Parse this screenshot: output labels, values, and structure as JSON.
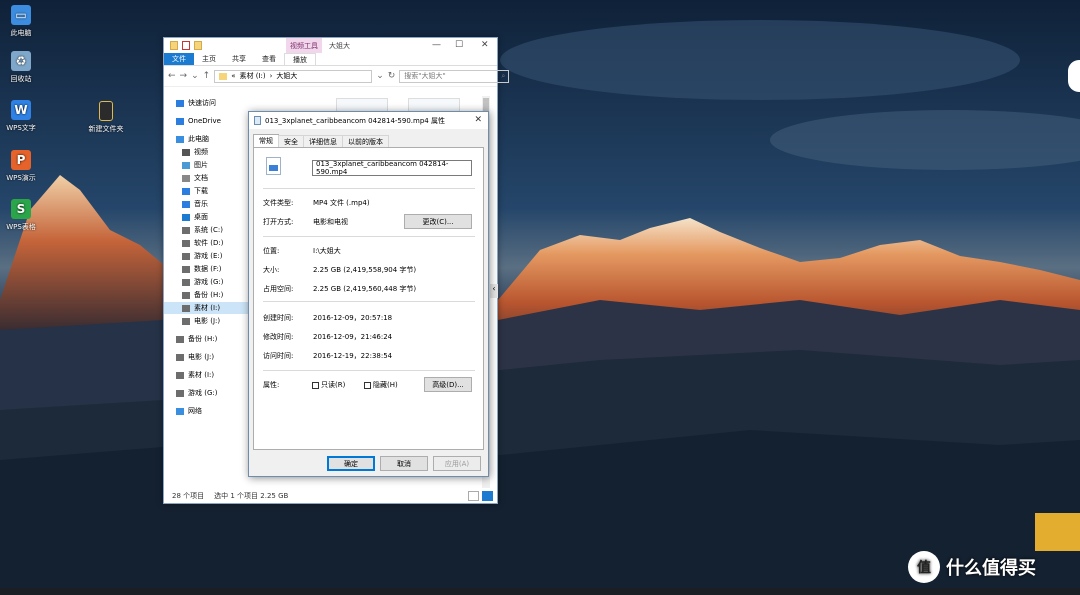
{
  "desktop": {
    "icons": [
      {
        "label": "此电脑",
        "icon": "computer-icon",
        "color": "#3c8de0"
      },
      {
        "label": "回收站",
        "icon": "recycle-bin-icon",
        "color": "#7fa7c9"
      },
      {
        "label": "WPS文字",
        "icon": "wps-writer-icon",
        "color": "#2f82e4",
        "glyph": "W"
      },
      {
        "label": "WPS演示",
        "icon": "wps-presentation-icon",
        "color": "#e5622b",
        "glyph": "P"
      },
      {
        "label": "WPS表格",
        "icon": "wps-spreadsheet-icon",
        "color": "#2aa54a",
        "glyph": "S"
      },
      {
        "label": "新建文件夹",
        "icon": "folder-icon",
        "color": "#2b2b2b"
      }
    ]
  },
  "explorer": {
    "context_tab": "视频工具",
    "window_title": "大姐大",
    "ribbon_tabs": [
      "文件",
      "主页",
      "共享",
      "查看",
      "播放"
    ],
    "address_parts": [
      "素材 (I:)",
      "大姐大"
    ],
    "search_placeholder": "搜索\"大姐大\"",
    "nav": [
      {
        "label": "快速访问",
        "icon": "star-icon",
        "indent": 0
      },
      {
        "label": "OneDrive",
        "icon": "cloud-icon",
        "indent": 0
      },
      {
        "label": "此电脑",
        "icon": "computer-icon",
        "indent": 0
      },
      {
        "label": "视频",
        "icon": "video-icon",
        "indent": 1
      },
      {
        "label": "图片",
        "icon": "picture-icon",
        "indent": 1
      },
      {
        "label": "文档",
        "icon": "document-icon",
        "indent": 1
      },
      {
        "label": "下载",
        "icon": "download-icon",
        "indent": 1
      },
      {
        "label": "音乐",
        "icon": "music-icon",
        "indent": 1
      },
      {
        "label": "桌面",
        "icon": "desktop-icon",
        "indent": 1
      },
      {
        "label": "系统 (C:)",
        "icon": "drive-icon",
        "indent": 1
      },
      {
        "label": "软件 (D:)",
        "icon": "drive-icon",
        "indent": 1
      },
      {
        "label": "游戏 (E:)",
        "icon": "drive-icon",
        "indent": 1
      },
      {
        "label": "数据 (F:)",
        "icon": "drive-icon",
        "indent": 1
      },
      {
        "label": "游戏 (G:)",
        "icon": "drive-icon",
        "indent": 1
      },
      {
        "label": "备份 (H:)",
        "icon": "drive-icon",
        "indent": 1
      },
      {
        "label": "素材 (I:)",
        "icon": "drive-icon",
        "indent": 1,
        "selected": true
      },
      {
        "label": "电影 (J:)",
        "icon": "drive-icon",
        "indent": 1
      },
      {
        "label": "备份 (H:)",
        "icon": "drive-icon",
        "indent": 0
      },
      {
        "label": "电影 (J:)",
        "icon": "drive-icon",
        "indent": 0
      },
      {
        "label": "素材 (I:)",
        "icon": "drive-icon",
        "indent": 0
      },
      {
        "label": "游戏 (G:)",
        "icon": "drive-icon",
        "indent": 0
      },
      {
        "label": "网络",
        "icon": "network-icon",
        "indent": 0
      }
    ],
    "status": {
      "count": "28 个项目",
      "selection": "选中 1 个项目  2.25 GB"
    }
  },
  "dialog": {
    "title": "013_3xplanet_caribbeancom 042814-590.mp4 属性",
    "tabs": [
      "常规",
      "安全",
      "详细信息",
      "以前的版本"
    ],
    "file_name": "013_3xplanet_caribbeancom 042814-590.mp4",
    "type_label": "文件类型:",
    "type_value": "MP4 文件 (.mp4)",
    "open_label": "打开方式:",
    "open_value": "电影和电视",
    "change_button": "更改(C)...",
    "location_label": "位置:",
    "location_value": "I:\\大姐大",
    "size_label": "大小:",
    "size_value": "2.25 GB (2,419,558,904 字节)",
    "disk_label": "占用空间:",
    "disk_value": "2.25 GB (2,419,560,448 字节)",
    "created_label": "创建时间:",
    "created_value": "2016-12-09，20:57:18",
    "modified_label": "修改时间:",
    "modified_value": "2016-12-09，21:46:24",
    "accessed_label": "访问时间:",
    "accessed_value": "2016-12-19，22:38:54",
    "attr_label": "属性:",
    "readonly_label": "只读(R)",
    "hidden_label": "隐藏(H)",
    "advanced_button": "高级(D)...",
    "ok_button": "确定",
    "cancel_button": "取消",
    "apply_button": "应用(A)"
  },
  "brand": {
    "name": "什么值得买",
    "glyph": "值"
  }
}
